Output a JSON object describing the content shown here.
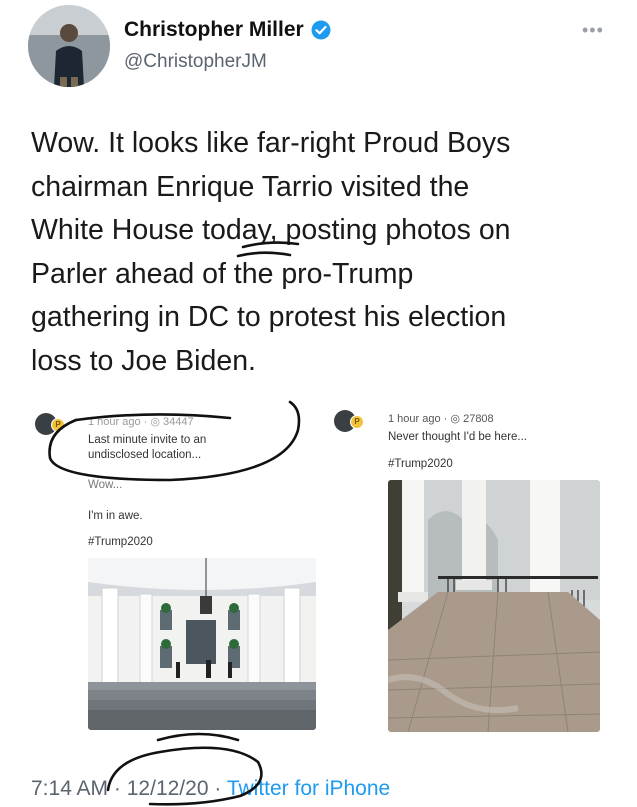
{
  "tweet": {
    "author_name": "Christopher Miller",
    "author_handle": "@ChristopherJM",
    "verified": true,
    "text": "Wow. It looks like far-right Proud Boys\nchairman Enrique Tarrio visited the\nWhite House today, posting photos on\nParler ahead of the pro-Trump\ngathering in DC to protest his election\nloss to Joe Biden.",
    "time": "7:14 AM",
    "date": "12/12/20",
    "separator": "·",
    "source": "Twitter for iPhone"
  },
  "embedded_posts": [
    {
      "meta": "1 hour ago · ◎ 34447",
      "caption_1": "Last minute invite to an",
      "caption_2": "undisclosed location...",
      "caption_3": "Wow...",
      "caption_4": "I'm in awe.",
      "hashtag": "#Trump2020"
    },
    {
      "meta_time": "1 hour ago",
      "meta_views": "27808",
      "caption_1": "Never thought I'd be here...",
      "hashtag": "#Trump2020"
    }
  ],
  "icons": [
    "verified-badge-icon",
    "more-options-icon",
    "views-icon"
  ],
  "colors": {
    "link": "#1d9bf0",
    "verified": "#1d9bf0",
    "secondary_text": "#5b6470"
  }
}
